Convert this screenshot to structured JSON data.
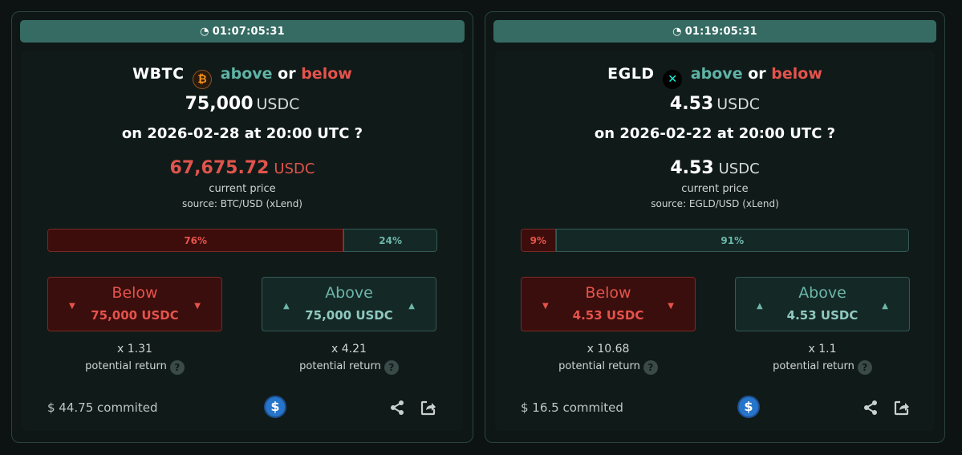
{
  "markets": [
    {
      "timer": "01:07:05:31",
      "asset": "WBTC",
      "asset_icon": "bitcoin-icon",
      "above_word": "above",
      "or_word": "or",
      "below_word": "below",
      "target_value": "75,000",
      "target_unit": "USDC",
      "date_line": "on 2026-02-28 at 20:00 UTC ?",
      "current_price": "67,675.72",
      "current_price_unit": "USDC",
      "current_price_label": "current price",
      "source": "source: BTC/USD (xLend)",
      "below_pct_label": "76%",
      "above_pct_label": "24%",
      "below_pct": 76,
      "above_pct": 24,
      "below_button": {
        "label": "Below",
        "sub": "75,000 USDC"
      },
      "above_button": {
        "label": "Above",
        "sub": "75,000 USDC"
      },
      "below_multiplier": "x 1.31",
      "above_multiplier": "x 4.21",
      "potential_return": "potential return",
      "committed": "$ 44.75 commited"
    },
    {
      "timer": "01:19:05:31",
      "asset": "EGLD",
      "asset_icon": "multiversx-icon",
      "above_word": "above",
      "or_word": "or",
      "below_word": "below",
      "target_value": "4.53",
      "target_unit": "USDC",
      "date_line": "on 2026-02-22 at 20:00 UTC ?",
      "current_price": "4.53",
      "current_price_unit": "USDC",
      "current_price_label": "current price",
      "source": "source: EGLD/USD (xLend)",
      "below_pct_label": "9%",
      "above_pct_label": "91%",
      "below_pct": 9,
      "above_pct": 91,
      "below_button": {
        "label": "Below",
        "sub": "4.53 USDC"
      },
      "above_button": {
        "label": "Above",
        "sub": "4.53 USDC"
      },
      "below_multiplier": "x 10.68",
      "above_multiplier": "x 1.1",
      "potential_return": "potential return",
      "committed": "$ 16.5 commited"
    }
  ],
  "colors": {
    "accent_green": "#5fb3a6",
    "accent_red": "#e5534b",
    "timer_bg": "#366b63",
    "usdc_blue": "#2775ca"
  }
}
